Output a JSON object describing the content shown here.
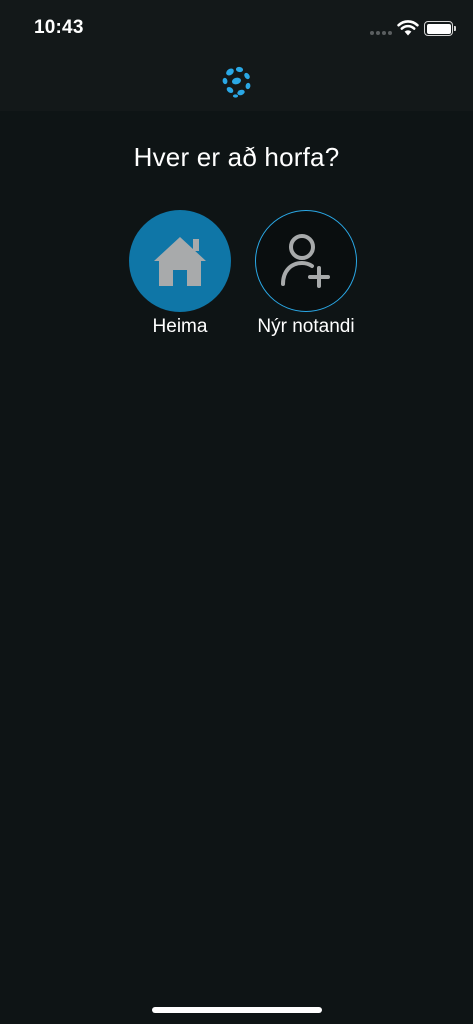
{
  "status_bar": {
    "time": "10:43",
    "icons": [
      "signal-dots-icon",
      "wifi-icon",
      "battery-icon"
    ]
  },
  "header": {
    "logo_icon": "brand-logo-icon",
    "logo_color": "#2aa8e6"
  },
  "main": {
    "title": "Hver er að horfa?",
    "profiles": [
      {
        "label": "Heima",
        "icon": "house-icon",
        "color": "#0f76a7"
      },
      {
        "label": "Nýr notandi",
        "icon": "add-user-icon",
        "color": "#2aa8e6"
      }
    ]
  }
}
